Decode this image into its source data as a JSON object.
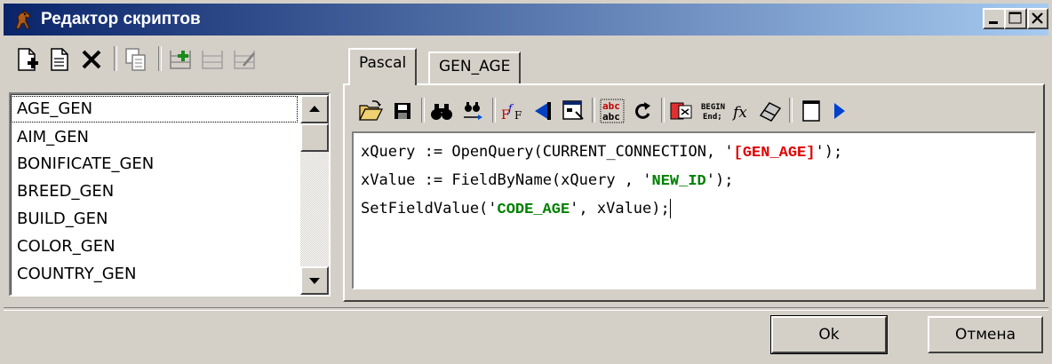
{
  "window": {
    "title": "Редактор скриптов",
    "controls": [
      "minimize-icon",
      "maximize-icon",
      "close-icon"
    ]
  },
  "left_toolbar": {
    "icons": [
      "new-script-icon",
      "open-script-icon",
      "delete-icon",
      "copy-icon",
      "add-icon",
      "move-icon",
      "rename-icon"
    ]
  },
  "script_list": {
    "items": [
      "AGE_GEN",
      "AIM_GEN",
      "BONIFICATE_GEN",
      "BREED_GEN",
      "BUILD_GEN",
      "COLOR_GEN",
      "COUNTRY_GEN"
    ],
    "selected": "AGE_GEN"
  },
  "tabs": [
    {
      "label": "Pascal",
      "active": true
    },
    {
      "label": "GEN_AGE",
      "active": false
    }
  ],
  "editor_toolbar": {
    "icons": [
      "open-folder-icon",
      "save-icon",
      "find-icon",
      "find-next-icon",
      "font-icon",
      "text-align-icon",
      "form-icon",
      "spell-check-icon",
      "redo-icon",
      "insert-variable-icon",
      "begin-end-icon",
      "function-icon",
      "eraser-icon",
      "page-icon",
      "run-icon"
    ]
  },
  "code": {
    "line1_prefix": "xQuery := OpenQuery(CURRENT_CONNECTION, '",
    "line1_str": "[GEN_AGE]",
    "line1_suffix": "');",
    "line2_prefix": "xValue := FieldByName(xQuery , '",
    "line2_str": "NEW_ID",
    "line2_suffix": "');",
    "line3_prefix": "SetFieldValue('",
    "line3_str": "CODE_AGE",
    "line3_suffix": "', xValue);"
  },
  "buttons": {
    "ok": "Ok",
    "cancel": "Отмена"
  },
  "colors": {
    "titlebar_start": "#0a246a",
    "titlebar_end": "#a6caf0",
    "face": "#d4d0c8",
    "string_red": "#e00000",
    "string_green": "#008000"
  }
}
